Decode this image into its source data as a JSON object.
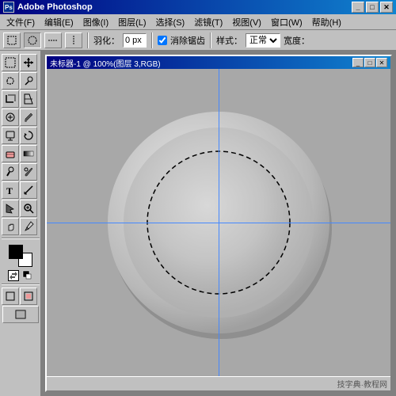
{
  "app": {
    "title": "Adobe Photoshop",
    "icon": "PS"
  },
  "title_controls": {
    "minimize": "_",
    "maximize": "□",
    "close": "✕"
  },
  "menu": {
    "items": [
      "文件(F)",
      "编辑(E)",
      "图像(I)",
      "图层(L)",
      "选择(S)",
      "滤镜(T)",
      "视图(V)",
      "窗口(W)",
      "帮助(H)"
    ]
  },
  "options_bar": {
    "feather_label": "羽化：",
    "feather_value": "0 px",
    "antialias_label": "✓ 消除锯齿",
    "style_label": "样式：",
    "style_value": "正常",
    "width_label": "宽度："
  },
  "document": {
    "title": "未标器-1 @ 100%(图层 3,RGB)",
    "controls": {
      "minimize": "_",
      "restore": "□",
      "close": "✕"
    }
  },
  "tools": {
    "rows": [
      [
        "marquee",
        "move"
      ],
      [
        "lasso",
        "magic-wand"
      ],
      [
        "crop",
        "slice"
      ],
      [
        "heal",
        "brush"
      ],
      [
        "stamp",
        "history"
      ],
      [
        "eraser",
        "gradient"
      ],
      [
        "dodge",
        "pen"
      ],
      [
        "text",
        "measure"
      ],
      [
        "path",
        "zoom"
      ],
      [
        "hand",
        "eyedropper"
      ]
    ]
  },
  "watermark": {
    "text": "技字典·教程网"
  }
}
